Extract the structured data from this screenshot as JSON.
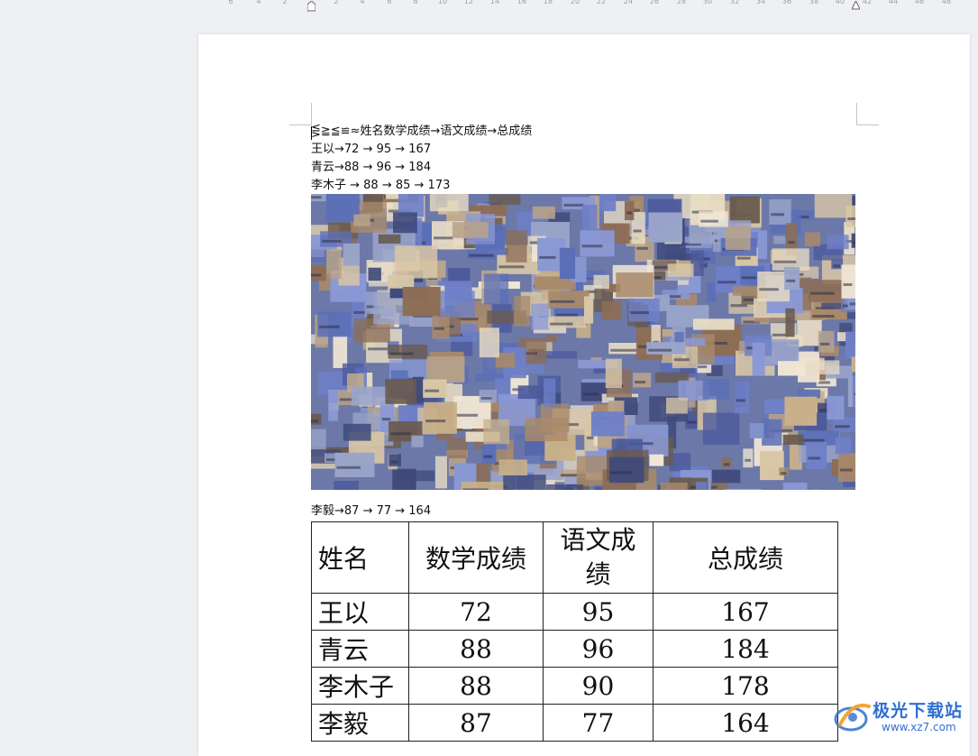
{
  "ruler": {
    "ticks": [
      "6",
      "4",
      "2",
      "2",
      "4",
      "6",
      "8",
      "10",
      "12",
      "14",
      "16",
      "18",
      "20",
      "22",
      "24",
      "26",
      "28",
      "30",
      "32",
      "34",
      "36",
      "38",
      "40",
      "42",
      "44",
      "46",
      "48"
    ]
  },
  "document": {
    "header_line": "⋚≧≦≌≈姓名数学成绩→语文成绩→总成绩",
    "lines": [
      "王以→72 → 95 → 167",
      "青云→88 → 96 → 184",
      "李木子 → 88 → 85 → 173"
    ],
    "after_image_line": "李毅→87 → 77 → 164",
    "table": {
      "headers": [
        "姓名",
        "数学成绩",
        "语文成绩",
        "总成绩"
      ],
      "header_lines": [
        [
          "姓名"
        ],
        [
          "数学成绩"
        ],
        [
          "语文成",
          "绩"
        ],
        [
          "总成绩"
        ]
      ],
      "rows": [
        [
          "王以",
          "72",
          "95",
          "167"
        ],
        [
          "青云",
          "88",
          "96",
          "184"
        ],
        [
          "李木子",
          "88",
          "90",
          "178"
        ],
        [
          "李毅",
          "87",
          "77",
          "164"
        ]
      ]
    }
  },
  "watermark": {
    "brand": "极光下载站",
    "url": "www.xz7.com"
  },
  "colors": {
    "workspace": "#eef0f4",
    "page": "#ffffff",
    "watermark": "#2f6fd0"
  }
}
